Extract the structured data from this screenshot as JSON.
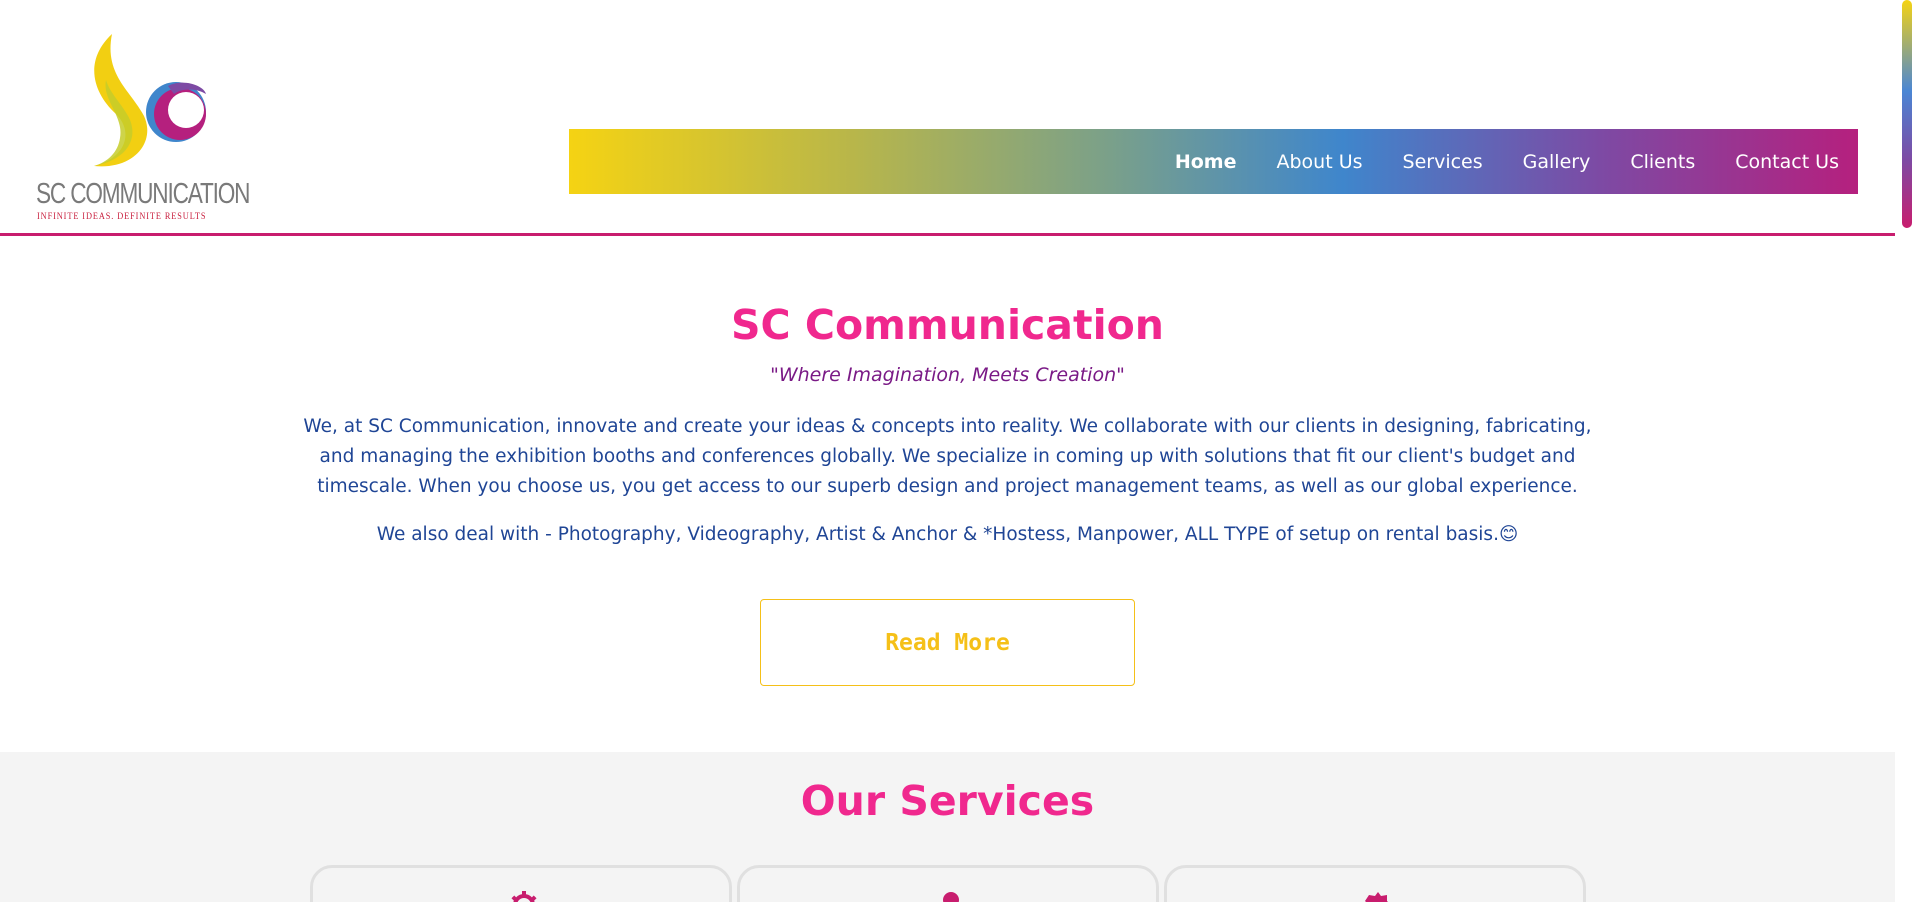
{
  "logo": {
    "name": "SC COMMUNICATION",
    "tagline": "INFINITE IDEAS. DEFINITE RESULTS"
  },
  "nav": {
    "items": [
      {
        "label": "Home",
        "active": true
      },
      {
        "label": "About Us",
        "active": false
      },
      {
        "label": "Services",
        "active": false
      },
      {
        "label": "Gallery",
        "active": false
      },
      {
        "label": "Clients",
        "active": false
      },
      {
        "label": "Contact Us",
        "active": false
      }
    ]
  },
  "intro": {
    "title": "SC Communication",
    "tagline": "\"Where Imagination, Meets Creation\"",
    "description": "We, at SC Communication, innovate and create your ideas & concepts into reality. We collaborate with our clients in designing, fabricating, and managing the exhibition booths and conferences globally. We specialize in coming up with solutions that fit our client's budget and timescale. When you choose us, you get access to our superb design and project management teams, as well as our global experience.",
    "description2": "We also deal with - Photography, Videography, Artist & Anchor & *Hostess, Manpower, ALL TYPE of setup on rental basis.😊",
    "read_more": "Read More"
  },
  "services": {
    "title": "Our Services",
    "cards": [
      {
        "icon": "gear-icon"
      },
      {
        "icon": "user-icon"
      },
      {
        "icon": "badge-icon"
      }
    ]
  },
  "colors": {
    "accent_pink": "#f0288e",
    "text_blue": "#1f4595",
    "tagline_purple": "#7a1a86",
    "button_yellow": "#f5c018",
    "header_border": "#c81d6e"
  }
}
